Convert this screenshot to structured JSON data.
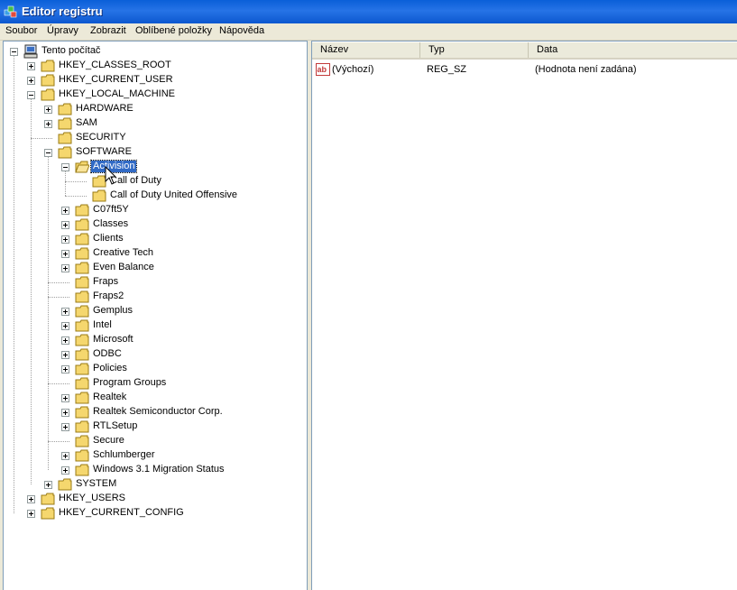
{
  "window": {
    "title": "Editor registru"
  },
  "menu": [
    "Soubor",
    "Úpravy",
    "Zobrazit",
    "Oblíbené položky",
    "Nápověda"
  ],
  "tree": {
    "root": "Tento počítač",
    "hkcr": "HKEY_CLASSES_ROOT",
    "hkcu": "HKEY_CURRENT_USER",
    "hklm": "HKEY_LOCAL_MACHINE",
    "hklm_children": [
      "HARDWARE",
      "SAM",
      "SECURITY",
      "SOFTWARE"
    ],
    "selected": "Activision",
    "activision_children": [
      "Call of Duty",
      "Call of Duty United Offensive"
    ],
    "software_children": [
      "C07ft5Y",
      "Classes",
      "Clients",
      "Creative Tech",
      "Even Balance",
      "Fraps",
      "Fraps2",
      "Gemplus",
      "Intel",
      "Microsoft",
      "ODBC",
      "Policies",
      "Program Groups",
      "Realtek",
      "Realtek Semiconductor Corp.",
      "RTLSetup",
      "Secure",
      "Schlumberger",
      "Windows 3.1 Migration Status"
    ],
    "system": "SYSTEM",
    "hku": "HKEY_USERS",
    "hkcc": "HKEY_CURRENT_CONFIG"
  },
  "list": {
    "columns": [
      "Název",
      "Typ",
      "Data"
    ],
    "rows": [
      {
        "name": "(Výchozí)",
        "type": "REG_SZ",
        "data": "(Hodnota není zadána)"
      }
    ]
  },
  "colors": {
    "titlebar": "#0a5fd8",
    "selection": "#316ac5",
    "folder": "#f5d76e"
  }
}
